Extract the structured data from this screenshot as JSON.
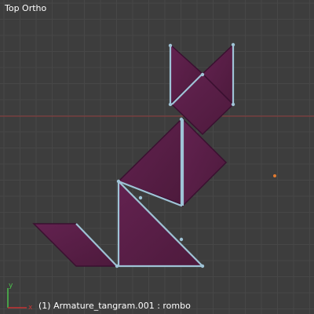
{
  "viewport": {
    "view_name": "Top Ortho",
    "status_text": "(1) Armature_tangram.001 : rombo",
    "colors": {
      "background": "#3d3d3d",
      "grid": "#474747",
      "x_axis": "#8f3b3b",
      "piece_fill": "#5a1f45",
      "piece_edge": "#3a1030",
      "bone_outline": "#9fc3d6",
      "selected_point": "#e07a2f",
      "gizmo_x": "#c53535",
      "gizmo_y": "#4cc24c"
    }
  },
  "axis_gizmo": {
    "x_label": "x",
    "y_label": "y"
  },
  "object_origin_marker": "origin-marker-icon"
}
